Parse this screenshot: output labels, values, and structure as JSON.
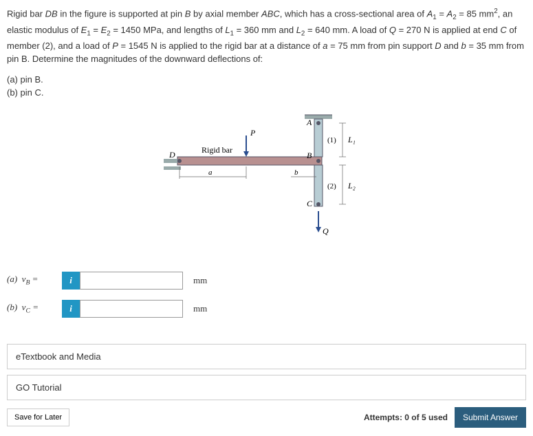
{
  "problem": {
    "text_html": "Rigid bar <i>DB</i> in the figure is supported at pin <i>B</i> by axial member <i>ABC</i>, which has a cross-sectional area of <i>A</i><sub>1</sub> = <i>A</i><sub>2</sub> = 85 mm<sup>2</sup>, an elastic modulus of <i>E</i><sub>1</sub> = <i>E</i><sub>2</sub> = 1450 MPa, and lengths of <i>L</i><sub>1</sub> = 360 mm and <i>L</i><sub>2</sub> = 640 mm. A load of <i>Q</i> = 270 N is applied at end <i>C</i> of member (2), and a load of <i>P</i> = 1545 N is applied to the rigid bar at a distance of <i>a</i> = 75 mm from pin support <i>D</i> and <i>b</i> = 35 mm from pin B. Determine the magnitudes of the downward deflections of:",
    "part_a": "(a) pin B.",
    "part_b": "(b) pin C."
  },
  "figure": {
    "labels": {
      "A": "A",
      "B": "B",
      "C": "C",
      "D": "D",
      "P": "P",
      "Q": "Q",
      "a": "a",
      "b": "b",
      "L1": "L₁",
      "L2": "L₂",
      "member1": "(1)",
      "member2": "(2)",
      "rigid_bar": "Rigid bar"
    }
  },
  "answers": {
    "a": {
      "label_html": "(a)&nbsp;&nbsp;<i>v<sub>B</sub></i> =",
      "value": "",
      "unit": "mm"
    },
    "b": {
      "label_html": "(b)&nbsp;&nbsp;<i>v<sub>C</sub></i> =",
      "value": "",
      "unit": "mm"
    }
  },
  "links": {
    "etextbook": "eTextbook and Media",
    "tutorial": "GO Tutorial"
  },
  "footer": {
    "save": "Save for Later",
    "attempts": "Attempts: 0 of 5 used",
    "submit": "Submit Answer"
  }
}
